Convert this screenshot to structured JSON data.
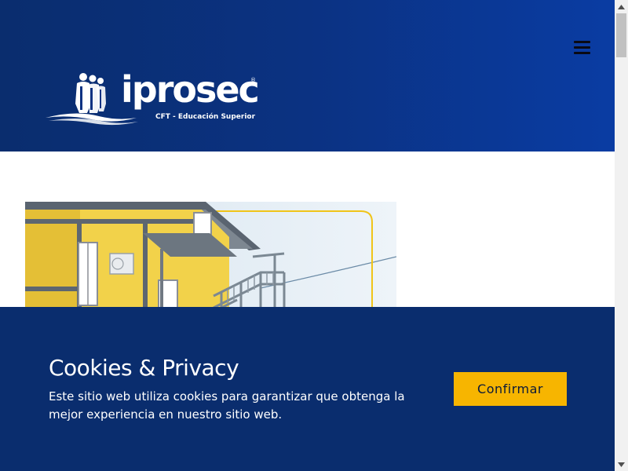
{
  "header": {
    "logo": {
      "wordmark": "iprosec",
      "registered_mark": "®",
      "tagline": "CFT - Educación Superior"
    },
    "menu_icon": "hamburger-menu-icon",
    "colors": {
      "background": "#0b3282",
      "text": "#ffffff"
    }
  },
  "hero": {
    "image": "building-photo",
    "accent_color": "#f0c419"
  },
  "cookie_banner": {
    "title": "Cookies & Privacy",
    "message": "Este sitio web utiliza cookies para garantizar que obtenga la mejor experiencia en nuestro sitio web.",
    "confirm_label": "Confirmar",
    "colors": {
      "background": "#0a2d6e",
      "button": "#f7b500"
    }
  },
  "scrollbar": {
    "up_icon": "arrow-up-icon",
    "down_icon": "arrow-down-icon"
  }
}
